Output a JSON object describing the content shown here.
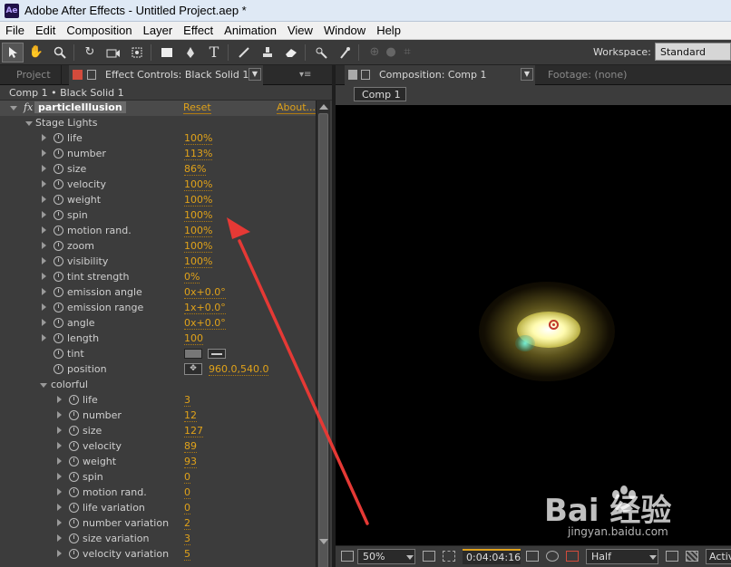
{
  "app": {
    "logo": "Ae",
    "title": "Adobe After Effects - Untitled Project.aep *"
  },
  "menu": [
    "File",
    "Edit",
    "Composition",
    "Layer",
    "Effect",
    "Animation",
    "View",
    "Window",
    "Help"
  ],
  "toolbar": {
    "workspace_label": "Workspace:",
    "workspace_value": "Standard"
  },
  "left_panel": {
    "tab_project": "Project",
    "tab_effect_controls": "Effect Controls: Black Solid 1",
    "header": "Comp 1 • Black Solid 1",
    "effect": {
      "fx": "fx",
      "name": "particleIllusion",
      "reset": "Reset",
      "about": "About..."
    },
    "group_stage": "Stage Lights",
    "stage_params": [
      {
        "label": "life",
        "value": "100%"
      },
      {
        "label": "number",
        "value": "113%"
      },
      {
        "label": "size",
        "value": "86%"
      },
      {
        "label": "velocity",
        "value": "100%"
      },
      {
        "label": "weight",
        "value": "100%"
      },
      {
        "label": "spin",
        "value": "100%"
      },
      {
        "label": "motion rand.",
        "value": "100%"
      },
      {
        "label": "zoom",
        "value": "100%"
      },
      {
        "label": "visibility",
        "value": "100%"
      },
      {
        "label": "tint strength",
        "value": "0%"
      },
      {
        "label": "emission angle",
        "value": "0x+0.0°"
      },
      {
        "label": "emission range",
        "value": "1x+0.0°"
      },
      {
        "label": "angle",
        "value": "0x+0.0°"
      },
      {
        "label": "length",
        "value": "100"
      }
    ],
    "tint_label": "tint",
    "tint_color": "#777777",
    "position_label": "position",
    "position_value": "960.0,540.0",
    "group_colorful": "colorful",
    "colorful_params": [
      {
        "label": "life",
        "value": "3"
      },
      {
        "label": "number",
        "value": "12"
      },
      {
        "label": "size",
        "value": "127"
      },
      {
        "label": "velocity",
        "value": "89"
      },
      {
        "label": "weight",
        "value": "93"
      },
      {
        "label": "spin",
        "value": "0"
      },
      {
        "label": "motion rand.",
        "value": "0"
      },
      {
        "label": "life variation",
        "value": "0"
      },
      {
        "label": "number variation",
        "value": "2"
      },
      {
        "label": "size variation",
        "value": "3"
      },
      {
        "label": "velocity variation",
        "value": "5"
      }
    ]
  },
  "right_panel": {
    "tab_composition": "Composition: Comp 1",
    "tab_footage": "Footage: (none)",
    "comp_chip": "Comp 1",
    "zoom": "50%",
    "timecode": "0:04:04:16",
    "resolution": "Half",
    "camera": "Active Camera"
  },
  "watermark": {
    "main": "Bai 经验",
    "sub": "jingyan.baidu.com"
  },
  "colors": {
    "value_accent": "#e0a21a",
    "annotation": "#e53935"
  },
  "icons": {
    "tools": [
      "selection-tool-icon",
      "hand-tool-icon",
      "zoom-tool-icon",
      "rotate-tool-icon",
      "camera-tool-icon",
      "pan-behind-tool-icon",
      "rectangle-tool-icon",
      "pen-tool-icon",
      "type-tool-icon",
      "brush-tool-icon",
      "clone-stamp-tool-icon",
      "eraser-tool-icon",
      "roto-brush-tool-icon",
      "puppet-tool-icon"
    ]
  }
}
